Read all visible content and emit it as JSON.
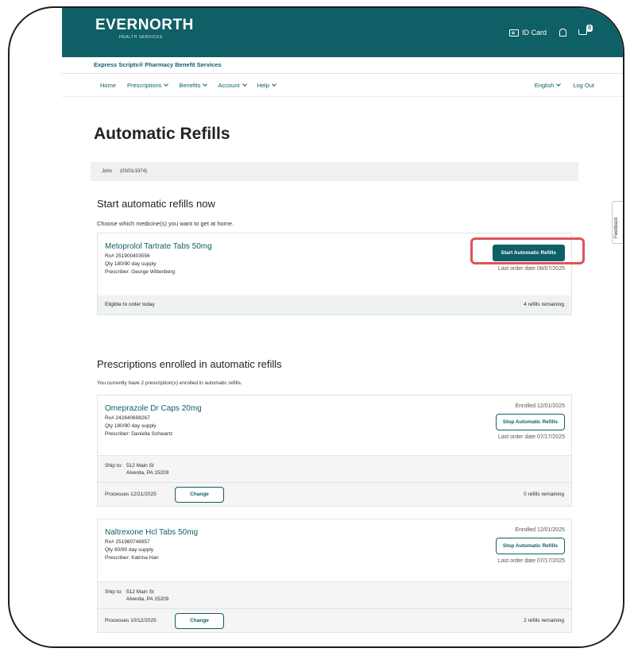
{
  "header": {
    "logo_main": "EVERNORTH",
    "logo_sub": "HEALTH SERVICES",
    "id_card_label": "ID Card",
    "cart_count": "0",
    "brand_line": "Express Scripts® Pharmacy Benefit Services"
  },
  "nav": {
    "left": [
      "Home",
      "Prescriptions",
      "Benefits",
      "Account",
      "Help"
    ],
    "language": "English",
    "logout": "Log Out"
  },
  "page": {
    "title": "Automatic Refills",
    "member_name": "John",
    "member_dob": "(03/01/1974)"
  },
  "start_section": {
    "title": "Start automatic refills now",
    "subtitle": "Choose which medicine(s) you want to get at home.",
    "card": {
      "drug": "Metoprolol Tartrate Tabs 50mg",
      "rx": "Rx# 251900403556",
      "qty": "Qty 180/90 day supply",
      "prescriber": "Prescriber: George Wittenberg",
      "button": "Start Automatic Refills",
      "last_order": "Last order date 08/07/2025",
      "eligibility": "Eligible to order today",
      "refills": "4 refills remaining"
    }
  },
  "enrolled_section": {
    "title": "Prescriptions enrolled in automatic refills",
    "subtitle": "You currently have 2 prescription(s) enrolled in automatic refills.",
    "cards": [
      {
        "drug": "Omeprazole Dr Caps 20mg",
        "rx": "Rx# 242840698267",
        "qty": "Qty 180/90 day supply",
        "prescriber": "Prescriber: Daniella Schwartz",
        "enrolled": "Enrolled 12/01/2025",
        "button": "Stop Automatic Refills",
        "last_order": "Last order date 07/17/2025",
        "ship_label": "Ship to:",
        "ship_line1": "512 Main St",
        "ship_line2": "Alverda, PA 15209",
        "processes": "Processes 12/21/2025",
        "change": "Change",
        "refills": "0 refills remaining"
      },
      {
        "drug": "Naltrexone Hcl Tabs 50mg",
        "rx": "Rx# 251980746957",
        "qty": "Qty 90/90 day supply",
        "prescriber": "Prescriber: Katrina Han",
        "enrolled": "Enrolled 12/01/2025",
        "button": "Stop Automatic Refills",
        "last_order": "Last order date 07/17/2025",
        "ship_label": "Ship to:",
        "ship_line1": "512 Main St",
        "ship_line2": "Alverda, PA 15209",
        "processes": "Processes 10/12/2025",
        "change": "Change",
        "refills": "2 refills remaining"
      }
    ]
  },
  "feedback_label": "Feedback",
  "colors": {
    "brand": "#0f5f66",
    "highlight": "#e0525a"
  }
}
